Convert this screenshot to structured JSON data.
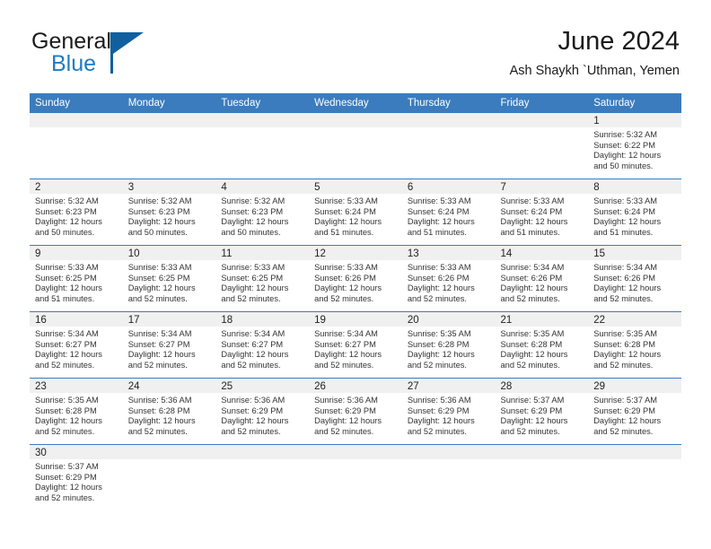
{
  "brand": {
    "name_part1": "General",
    "name_part2": "Blue",
    "accent_color": "#1f7ac4",
    "flag_color": "#10609f"
  },
  "header": {
    "title": "June 2024",
    "subtitle": "Ash Shaykh `Uthman, Yemen"
  },
  "theme": {
    "header_blue": "#3a7cbe",
    "daynum_band": "#f0f0f0",
    "text": "#333333"
  },
  "weekdays": [
    "Sunday",
    "Monday",
    "Tuesday",
    "Wednesday",
    "Thursday",
    "Friday",
    "Saturday"
  ],
  "weeks": [
    [
      {
        "day": "",
        "blank": true,
        "sunrise": "",
        "sunset": "",
        "daylight1": "",
        "daylight2": ""
      },
      {
        "day": "",
        "blank": true,
        "sunrise": "",
        "sunset": "",
        "daylight1": "",
        "daylight2": ""
      },
      {
        "day": "",
        "blank": true,
        "sunrise": "",
        "sunset": "",
        "daylight1": "",
        "daylight2": ""
      },
      {
        "day": "",
        "blank": true,
        "sunrise": "",
        "sunset": "",
        "daylight1": "",
        "daylight2": ""
      },
      {
        "day": "",
        "blank": true,
        "sunrise": "",
        "sunset": "",
        "daylight1": "",
        "daylight2": ""
      },
      {
        "day": "",
        "blank": true,
        "sunrise": "",
        "sunset": "",
        "daylight1": "",
        "daylight2": ""
      },
      {
        "day": "1",
        "blank": false,
        "sunrise": "Sunrise: 5:32 AM",
        "sunset": "Sunset: 6:22 PM",
        "daylight1": "Daylight: 12 hours",
        "daylight2": "and 50 minutes."
      }
    ],
    [
      {
        "day": "2",
        "blank": false,
        "sunrise": "Sunrise: 5:32 AM",
        "sunset": "Sunset: 6:23 PM",
        "daylight1": "Daylight: 12 hours",
        "daylight2": "and 50 minutes."
      },
      {
        "day": "3",
        "blank": false,
        "sunrise": "Sunrise: 5:32 AM",
        "sunset": "Sunset: 6:23 PM",
        "daylight1": "Daylight: 12 hours",
        "daylight2": "and 50 minutes."
      },
      {
        "day": "4",
        "blank": false,
        "sunrise": "Sunrise: 5:32 AM",
        "sunset": "Sunset: 6:23 PM",
        "daylight1": "Daylight: 12 hours",
        "daylight2": "and 50 minutes."
      },
      {
        "day": "5",
        "blank": false,
        "sunrise": "Sunrise: 5:33 AM",
        "sunset": "Sunset: 6:24 PM",
        "daylight1": "Daylight: 12 hours",
        "daylight2": "and 51 minutes."
      },
      {
        "day": "6",
        "blank": false,
        "sunrise": "Sunrise: 5:33 AM",
        "sunset": "Sunset: 6:24 PM",
        "daylight1": "Daylight: 12 hours",
        "daylight2": "and 51 minutes."
      },
      {
        "day": "7",
        "blank": false,
        "sunrise": "Sunrise: 5:33 AM",
        "sunset": "Sunset: 6:24 PM",
        "daylight1": "Daylight: 12 hours",
        "daylight2": "and 51 minutes."
      },
      {
        "day": "8",
        "blank": false,
        "sunrise": "Sunrise: 5:33 AM",
        "sunset": "Sunset: 6:24 PM",
        "daylight1": "Daylight: 12 hours",
        "daylight2": "and 51 minutes."
      }
    ],
    [
      {
        "day": "9",
        "blank": false,
        "sunrise": "Sunrise: 5:33 AM",
        "sunset": "Sunset: 6:25 PM",
        "daylight1": "Daylight: 12 hours",
        "daylight2": "and 51 minutes."
      },
      {
        "day": "10",
        "blank": false,
        "sunrise": "Sunrise: 5:33 AM",
        "sunset": "Sunset: 6:25 PM",
        "daylight1": "Daylight: 12 hours",
        "daylight2": "and 52 minutes."
      },
      {
        "day": "11",
        "blank": false,
        "sunrise": "Sunrise: 5:33 AM",
        "sunset": "Sunset: 6:25 PM",
        "daylight1": "Daylight: 12 hours",
        "daylight2": "and 52 minutes."
      },
      {
        "day": "12",
        "blank": false,
        "sunrise": "Sunrise: 5:33 AM",
        "sunset": "Sunset: 6:26 PM",
        "daylight1": "Daylight: 12 hours",
        "daylight2": "and 52 minutes."
      },
      {
        "day": "13",
        "blank": false,
        "sunrise": "Sunrise: 5:33 AM",
        "sunset": "Sunset: 6:26 PM",
        "daylight1": "Daylight: 12 hours",
        "daylight2": "and 52 minutes."
      },
      {
        "day": "14",
        "blank": false,
        "sunrise": "Sunrise: 5:34 AM",
        "sunset": "Sunset: 6:26 PM",
        "daylight1": "Daylight: 12 hours",
        "daylight2": "and 52 minutes."
      },
      {
        "day": "15",
        "blank": false,
        "sunrise": "Sunrise: 5:34 AM",
        "sunset": "Sunset: 6:26 PM",
        "daylight1": "Daylight: 12 hours",
        "daylight2": "and 52 minutes."
      }
    ],
    [
      {
        "day": "16",
        "blank": false,
        "sunrise": "Sunrise: 5:34 AM",
        "sunset": "Sunset: 6:27 PM",
        "daylight1": "Daylight: 12 hours",
        "daylight2": "and 52 minutes."
      },
      {
        "day": "17",
        "blank": false,
        "sunrise": "Sunrise: 5:34 AM",
        "sunset": "Sunset: 6:27 PM",
        "daylight1": "Daylight: 12 hours",
        "daylight2": "and 52 minutes."
      },
      {
        "day": "18",
        "blank": false,
        "sunrise": "Sunrise: 5:34 AM",
        "sunset": "Sunset: 6:27 PM",
        "daylight1": "Daylight: 12 hours",
        "daylight2": "and 52 minutes."
      },
      {
        "day": "19",
        "blank": false,
        "sunrise": "Sunrise: 5:34 AM",
        "sunset": "Sunset: 6:27 PM",
        "daylight1": "Daylight: 12 hours",
        "daylight2": "and 52 minutes."
      },
      {
        "day": "20",
        "blank": false,
        "sunrise": "Sunrise: 5:35 AM",
        "sunset": "Sunset: 6:28 PM",
        "daylight1": "Daylight: 12 hours",
        "daylight2": "and 52 minutes."
      },
      {
        "day": "21",
        "blank": false,
        "sunrise": "Sunrise: 5:35 AM",
        "sunset": "Sunset: 6:28 PM",
        "daylight1": "Daylight: 12 hours",
        "daylight2": "and 52 minutes."
      },
      {
        "day": "22",
        "blank": false,
        "sunrise": "Sunrise: 5:35 AM",
        "sunset": "Sunset: 6:28 PM",
        "daylight1": "Daylight: 12 hours",
        "daylight2": "and 52 minutes."
      }
    ],
    [
      {
        "day": "23",
        "blank": false,
        "sunrise": "Sunrise: 5:35 AM",
        "sunset": "Sunset: 6:28 PM",
        "daylight1": "Daylight: 12 hours",
        "daylight2": "and 52 minutes."
      },
      {
        "day": "24",
        "blank": false,
        "sunrise": "Sunrise: 5:36 AM",
        "sunset": "Sunset: 6:28 PM",
        "daylight1": "Daylight: 12 hours",
        "daylight2": "and 52 minutes."
      },
      {
        "day": "25",
        "blank": false,
        "sunrise": "Sunrise: 5:36 AM",
        "sunset": "Sunset: 6:29 PM",
        "daylight1": "Daylight: 12 hours",
        "daylight2": "and 52 minutes."
      },
      {
        "day": "26",
        "blank": false,
        "sunrise": "Sunrise: 5:36 AM",
        "sunset": "Sunset: 6:29 PM",
        "daylight1": "Daylight: 12 hours",
        "daylight2": "and 52 minutes."
      },
      {
        "day": "27",
        "blank": false,
        "sunrise": "Sunrise: 5:36 AM",
        "sunset": "Sunset: 6:29 PM",
        "daylight1": "Daylight: 12 hours",
        "daylight2": "and 52 minutes."
      },
      {
        "day": "28",
        "blank": false,
        "sunrise": "Sunrise: 5:37 AM",
        "sunset": "Sunset: 6:29 PM",
        "daylight1": "Daylight: 12 hours",
        "daylight2": "and 52 minutes."
      },
      {
        "day": "29",
        "blank": false,
        "sunrise": "Sunrise: 5:37 AM",
        "sunset": "Sunset: 6:29 PM",
        "daylight1": "Daylight: 12 hours",
        "daylight2": "and 52 minutes."
      }
    ],
    [
      {
        "day": "30",
        "blank": false,
        "sunrise": "Sunrise: 5:37 AM",
        "sunset": "Sunset: 6:29 PM",
        "daylight1": "Daylight: 12 hours",
        "daylight2": "and 52 minutes."
      },
      {
        "day": "",
        "blank": true,
        "sunrise": "",
        "sunset": "",
        "daylight1": "",
        "daylight2": ""
      },
      {
        "day": "",
        "blank": true,
        "sunrise": "",
        "sunset": "",
        "daylight1": "",
        "daylight2": ""
      },
      {
        "day": "",
        "blank": true,
        "sunrise": "",
        "sunset": "",
        "daylight1": "",
        "daylight2": ""
      },
      {
        "day": "",
        "blank": true,
        "sunrise": "",
        "sunset": "",
        "daylight1": "",
        "daylight2": ""
      },
      {
        "day": "",
        "blank": true,
        "sunrise": "",
        "sunset": "",
        "daylight1": "",
        "daylight2": ""
      },
      {
        "day": "",
        "blank": true,
        "sunrise": "",
        "sunset": "",
        "daylight1": "",
        "daylight2": ""
      }
    ]
  ]
}
